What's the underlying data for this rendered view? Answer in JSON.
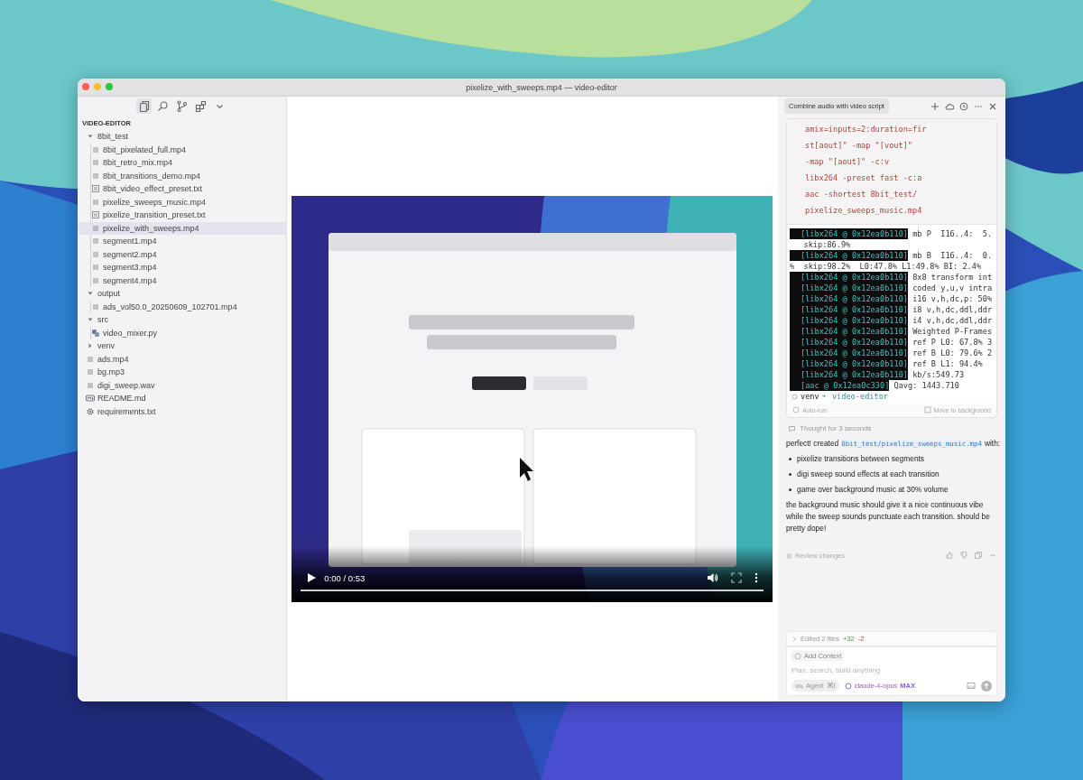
{
  "window": {
    "title": "pixelize_with_sweeps.mp4 — video-editor"
  },
  "sidebar": {
    "toolbar": [
      {
        "kind": "files",
        "selected": true
      },
      {
        "kind": "search",
        "selected": false
      },
      {
        "kind": "branch",
        "selected": false
      },
      {
        "kind": "extensions",
        "selected": false
      },
      {
        "kind": "chevron",
        "selected": false
      }
    ],
    "section": "VIDEO-EDITOR",
    "tree": [
      {
        "name": "8bit_test",
        "kind": "folder",
        "expanded": true,
        "selected": false,
        "children": [
          {
            "name": "8bit_pixelated_full.mp4",
            "kind": "media",
            "selected": false
          },
          {
            "name": "8bit_retro_mix.mp4",
            "kind": "media",
            "selected": false
          },
          {
            "name": "8bit_transitions_demo.mp4",
            "kind": "media",
            "selected": false
          },
          {
            "name": "8bit_video_effect_preset.txt",
            "kind": "text",
            "selected": false
          },
          {
            "name": "pixelize_sweeps_music.mp4",
            "kind": "media",
            "selected": false
          },
          {
            "name": "pixelize_transition_preset.txt",
            "kind": "text",
            "selected": false
          },
          {
            "name": "pixelize_with_sweeps.mp4",
            "kind": "media",
            "selected": true
          },
          {
            "name": "segment1.mp4",
            "kind": "media",
            "selected": false
          },
          {
            "name": "segment2.mp4",
            "kind": "media",
            "selected": false
          },
          {
            "name": "segment3.mp4",
            "kind": "media",
            "selected": false
          },
          {
            "name": "segment4.mp4",
            "kind": "media",
            "selected": false
          }
        ]
      },
      {
        "name": "output",
        "kind": "folder",
        "expanded": true,
        "selected": false,
        "children": [
          {
            "name": "ads_vol50.0_20250609_102701.mp4",
            "kind": "media",
            "selected": false
          }
        ]
      },
      {
        "name": "src",
        "kind": "folder",
        "expanded": true,
        "selected": false,
        "children": [
          {
            "name": "video_mixer.py",
            "kind": "python",
            "selected": false
          }
        ]
      },
      {
        "name": "venv",
        "kind": "folder",
        "expanded": false,
        "selected": false
      },
      {
        "name": "ads.mp4",
        "kind": "media",
        "selected": false
      },
      {
        "name": "bg.mp3",
        "kind": "media",
        "selected": false
      },
      {
        "name": "digi_sweep.wav",
        "kind": "media",
        "selected": false
      },
      {
        "name": "README.md",
        "kind": "markdown",
        "selected": false
      },
      {
        "name": "requirements.txt",
        "kind": "config",
        "selected": false
      }
    ]
  },
  "video": {
    "time": "0:00 / 0:53",
    "playing": false,
    "level": 0
  },
  "chat": {
    "tab": "Combine audio with video script",
    "command": [
      "amix=inputs=2:duration=fir",
      "st[aout]\" -map \"[vout]\"",
      "-map \"[aout]\" -c:v",
      "libx264 -preset fast -c:a",
      "aac -shortest 8bit_test/",
      "pixelize_sweeps_music.mp4"
    ],
    "terminal": {
      "lines": [
        {
          "prefix": "[libx264 @ 0x12ea0b110]",
          "text": " mb P  I16..4:  5."
        },
        {
          "text": "   skip:86.9%"
        },
        {
          "prefix": "[libx264 @ 0x12ea0b110]",
          "text": " mb B  I16..4:  0."
        },
        {
          "text": "%  skip:98.2%  L0:47.8% L1:49.8% BI: 2.4%"
        },
        {
          "prefix": "[libx264 @ 0x12ea0b110]",
          "text": " 8x8 transform int"
        },
        {
          "prefix": "[libx264 @ 0x12ea0b110]",
          "text": " coded y,u,v intra"
        },
        {
          "prefix": "[libx264 @ 0x12ea0b110]",
          "text": " i16 v,h,dc,p: 50%"
        },
        {
          "prefix": "[libx264 @ 0x12ea0b110]",
          "text": " i8 v,h,dc,ddl,ddr"
        },
        {
          "prefix": "[libx264 @ 0x12ea0b110]",
          "text": " i4 v,h,dc,ddl,ddr"
        },
        {
          "prefix": "[libx264 @ 0x12ea0b110]",
          "text": " Weighted P-Frames"
        },
        {
          "prefix": "[libx264 @ 0x12ea0b110]",
          "text": " ref P L0: 67.8% 3"
        },
        {
          "prefix": "[libx264 @ 0x12ea0b110]",
          "text": " ref B L0: 79.6% 2"
        },
        {
          "prefix": "[libx264 @ 0x12ea0b110]",
          "text": " ref B L1: 94.4%"
        },
        {
          "prefix": "[libx264 @ 0x12ea0b110]",
          "text": " kb/s:549.73"
        },
        {
          "prefix": "[aac @ 0x12ea0c330]",
          "text": " Qavg: 1443.710"
        }
      ],
      "prompt": {
        "env": "venv",
        "arrow": "➜",
        "dir": "video-editor"
      },
      "auto_run": "Auto-run",
      "move": "Move to background"
    },
    "thought": "Thought for 3 seconds",
    "message": {
      "intro": "perfect! created",
      "file": "8bit_test/pixelize_sweeps_music.mp4",
      "after": "with:",
      "bullets": [
        "pixelize transitions between segments",
        "digi sweep sound effects at each transition",
        "game over background music at 30% volume"
      ],
      "outro": "the background music should give it a nice continuous vibe while the sweep sounds punctuate each transition. should be pretty dope!"
    },
    "review": "Review changes",
    "edited": {
      "label": "Edited 2 files",
      "added": "+32",
      "removed": "-2"
    },
    "composer": {
      "context": "Add Context",
      "placeholder": "Plan, search, build anything",
      "agent": "Agent",
      "shortcut": "⌘I",
      "model": "claude-4-opus",
      "badge": "MAX"
    }
  }
}
